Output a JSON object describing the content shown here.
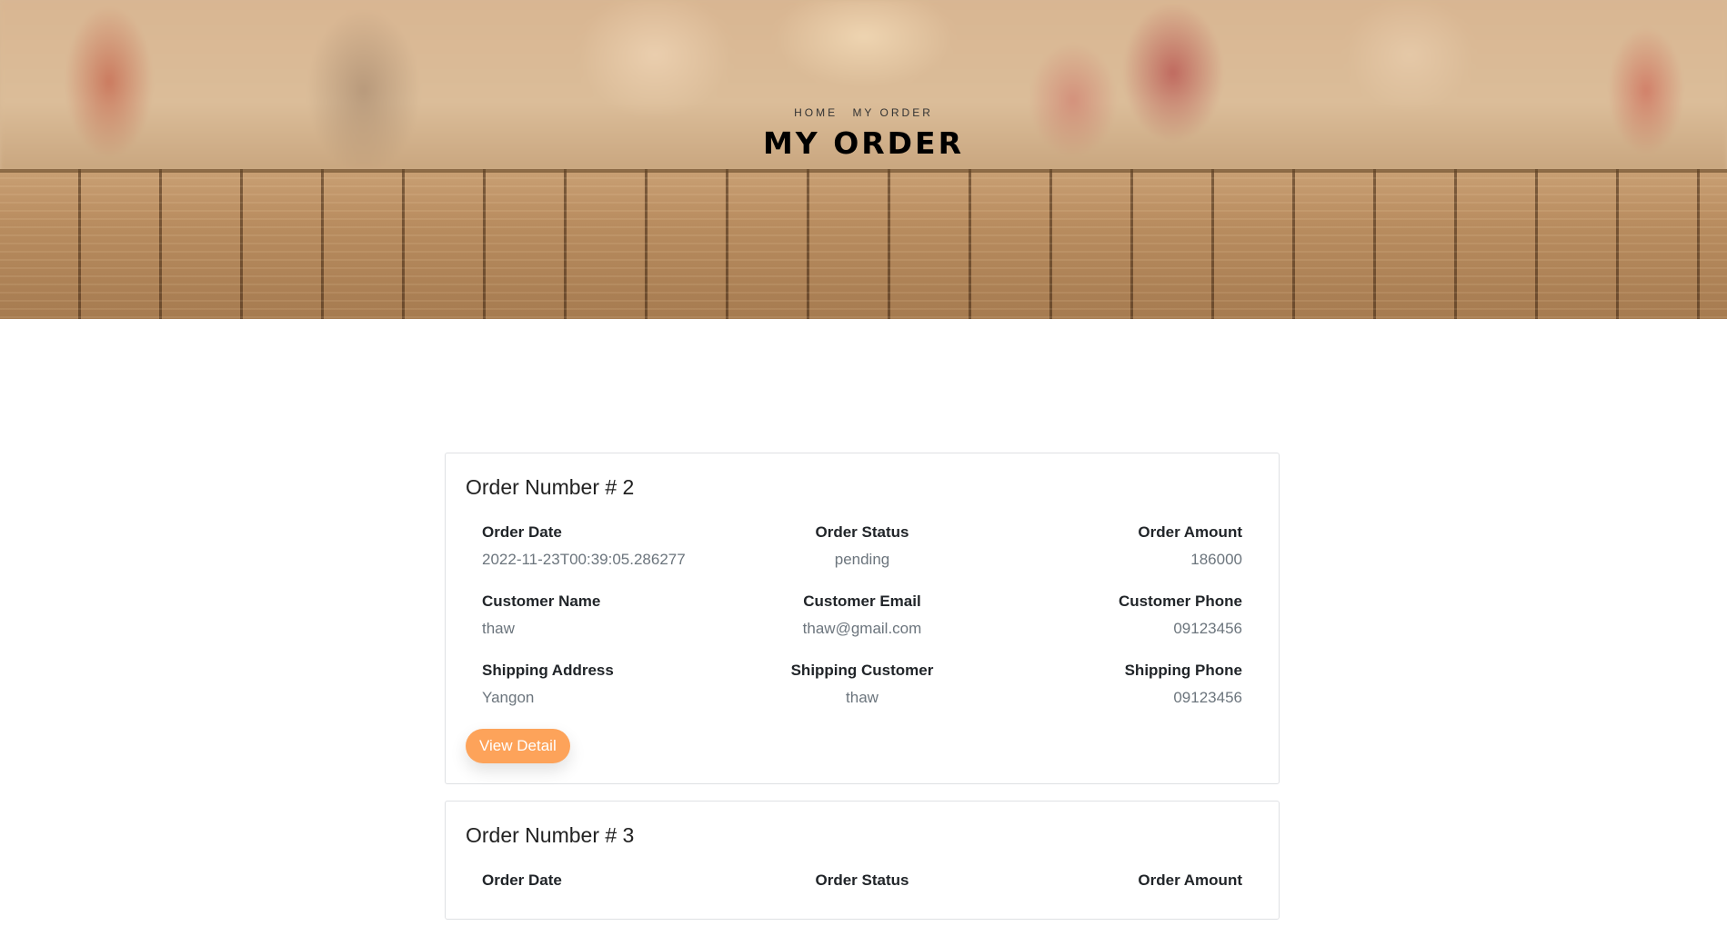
{
  "hero": {
    "breadcrumb": [
      "HOME",
      "MY ORDER"
    ],
    "title": "MY ORDER"
  },
  "colors": {
    "accent": "#fda35a",
    "label": "#212529",
    "value": "#6c757d",
    "card_border": "#dfe1e4"
  },
  "orders": [
    {
      "title": "Order Number # 2",
      "fields": {
        "order_date": {
          "label": "Order Date",
          "value": "2022-11-23T00:39:05.286277"
        },
        "order_status": {
          "label": "Order Status",
          "value": "pending"
        },
        "order_amount": {
          "label": "Order Amount",
          "value": "186000"
        },
        "customer_name": {
          "label": "Customer Name",
          "value": "thaw"
        },
        "customer_email": {
          "label": "Customer Email",
          "value": "thaw@gmail.com"
        },
        "customer_phone": {
          "label": "Customer Phone",
          "value": "09123456"
        },
        "shipping_address": {
          "label": "Shipping Address",
          "value": "Yangon"
        },
        "shipping_customer": {
          "label": "Shipping Customer",
          "value": "thaw"
        },
        "shipping_phone": {
          "label": "Shipping Phone",
          "value": "09123456"
        }
      },
      "button": "View Detail"
    },
    {
      "title": "Order Number # 3",
      "fields": {
        "order_date": {
          "label": "Order Date",
          "value": ""
        },
        "order_status": {
          "label": "Order Status",
          "value": ""
        },
        "order_amount": {
          "label": "Order Amount",
          "value": ""
        }
      }
    }
  ]
}
